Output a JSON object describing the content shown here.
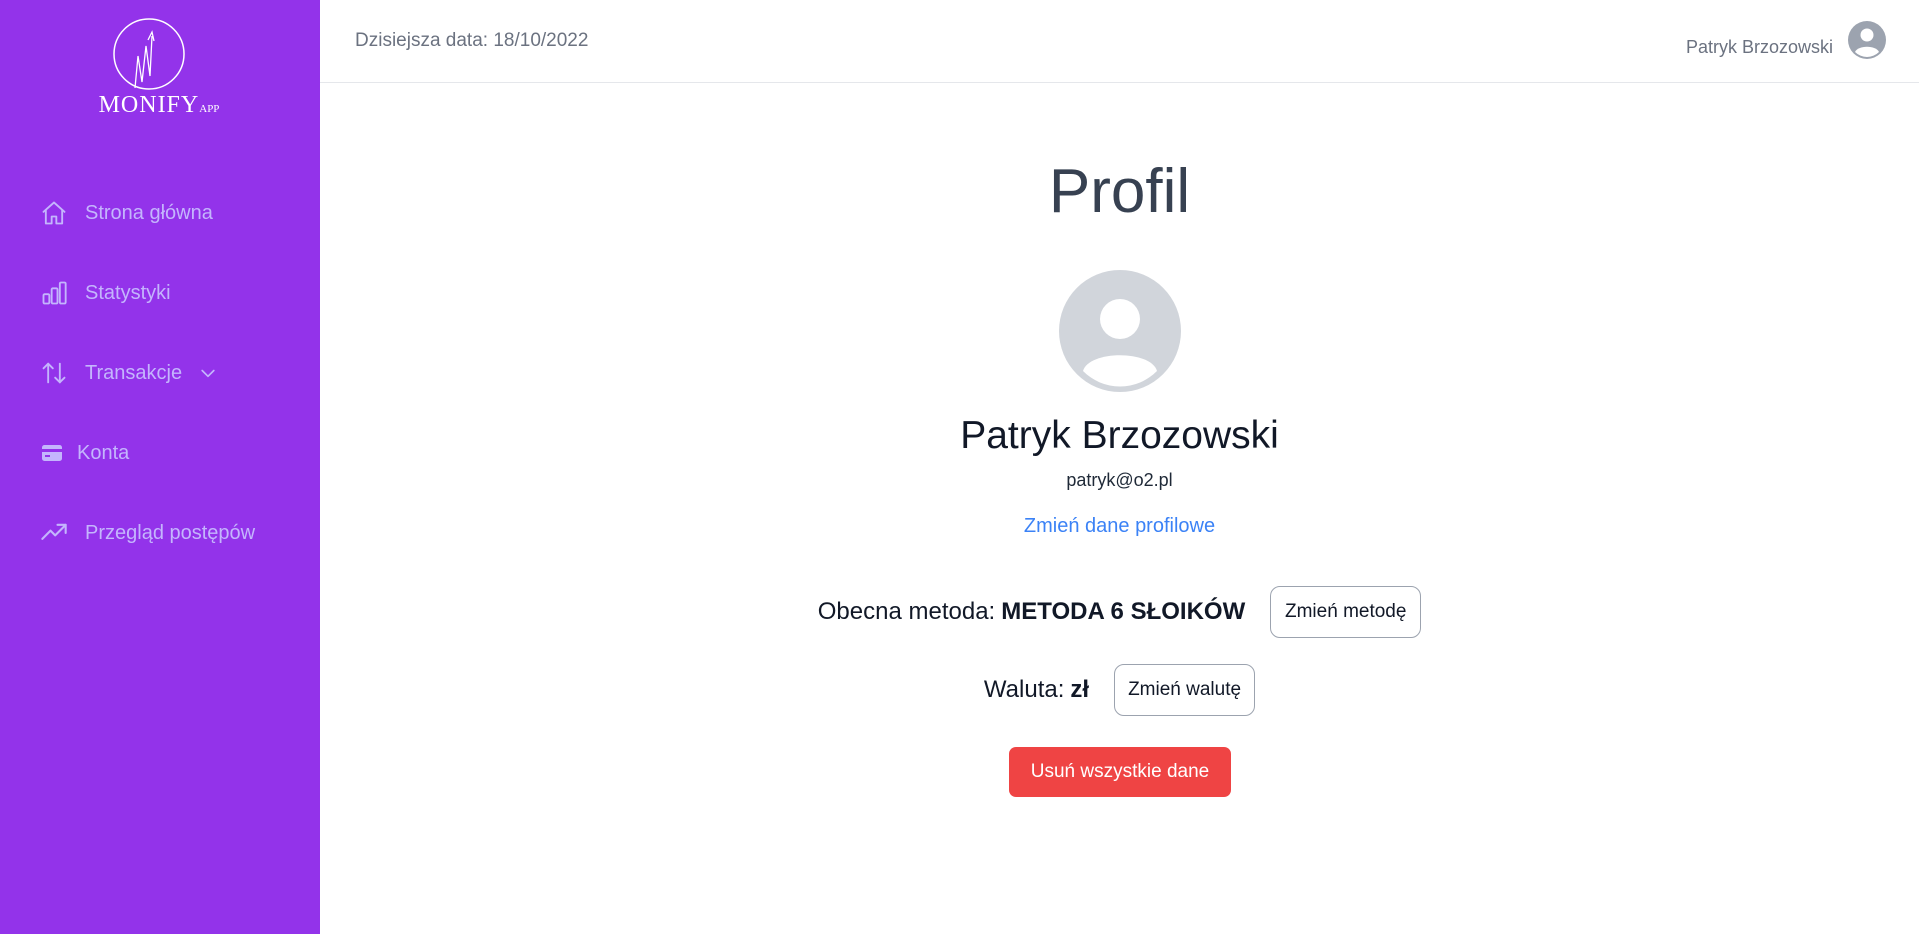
{
  "sidebar": {
    "logo": {
      "text": "MONIFY",
      "suffix": "APP"
    },
    "items": [
      {
        "label": "Strona główna",
        "icon": "home-icon"
      },
      {
        "label": "Statystyki",
        "icon": "bar-chart-icon"
      },
      {
        "label": "Transakcje",
        "icon": "arrows-up-down-icon"
      },
      {
        "label": "Konta",
        "icon": "credit-card-icon"
      },
      {
        "label": "Przegląd postępów",
        "icon": "trending-up-icon"
      }
    ]
  },
  "header": {
    "date_text": "Dzisiejsza data: 18/10/2022",
    "user_name": "Patryk Brzozowski"
  },
  "profile": {
    "title": "Profil",
    "name": "Patryk Brzozowski",
    "email": "patryk@o2.pl",
    "edit_link": "Zmień dane profilowe",
    "method_label": "Obecna metoda:",
    "method_value": "METODA 6 SŁOIKÓW",
    "change_method_button": "Zmień metodę",
    "currency_label": "Waluta:",
    "currency_value": "zł",
    "change_currency_button": "Zmień walutę",
    "delete_button": "Usuń wszystkie dane"
  },
  "colors": {
    "sidebar_bg": "#9333ea",
    "sidebar_text": "#c4b5fd",
    "link": "#3b82f6",
    "danger": "#ef4444"
  }
}
